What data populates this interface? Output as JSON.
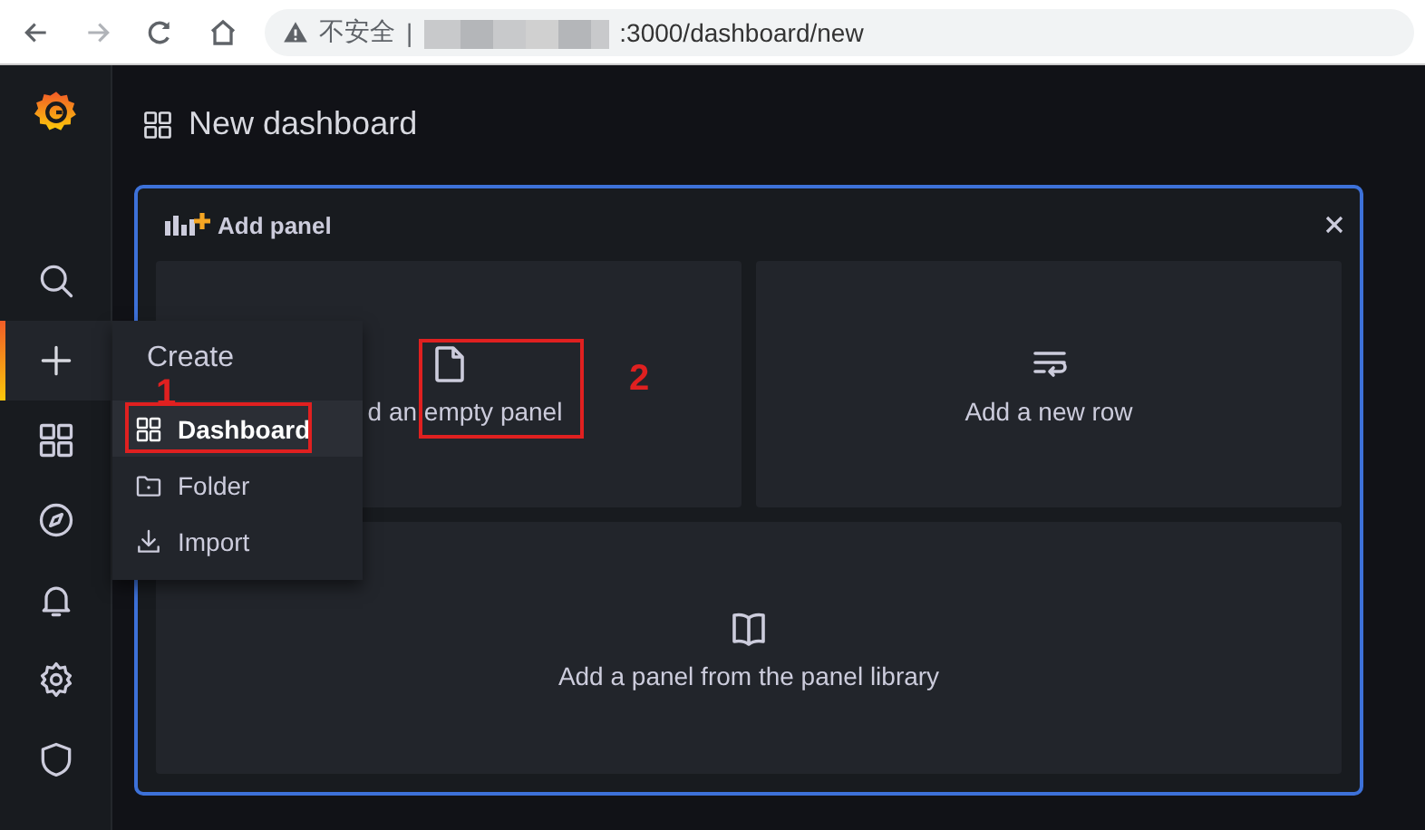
{
  "browser": {
    "warning": "不安全",
    "separator": "|",
    "url": ":3000/dashboard/new"
  },
  "sidebar": {
    "items": [
      {
        "selected": false
      },
      {
        "selected": true
      },
      {
        "selected": false
      },
      {
        "selected": false
      },
      {
        "selected": false
      },
      {
        "selected": false
      },
      {
        "selected": false
      }
    ]
  },
  "create_menu": {
    "title": "Create",
    "items": [
      {
        "label": "Dashboard",
        "selected": true
      },
      {
        "label": "Folder",
        "selected": false
      },
      {
        "label": "Import",
        "selected": false
      }
    ]
  },
  "page": {
    "title": "New dashboard"
  },
  "add_panel": {
    "title": "Add panel",
    "options": [
      {
        "kind": "empty",
        "label": "d an empty panel"
      },
      {
        "kind": "row",
        "label": "Add a new row"
      },
      {
        "kind": "library",
        "label": "Add a panel from the panel library"
      }
    ]
  },
  "annotations": [
    {
      "label": "1"
    },
    {
      "label": "2"
    }
  ]
}
